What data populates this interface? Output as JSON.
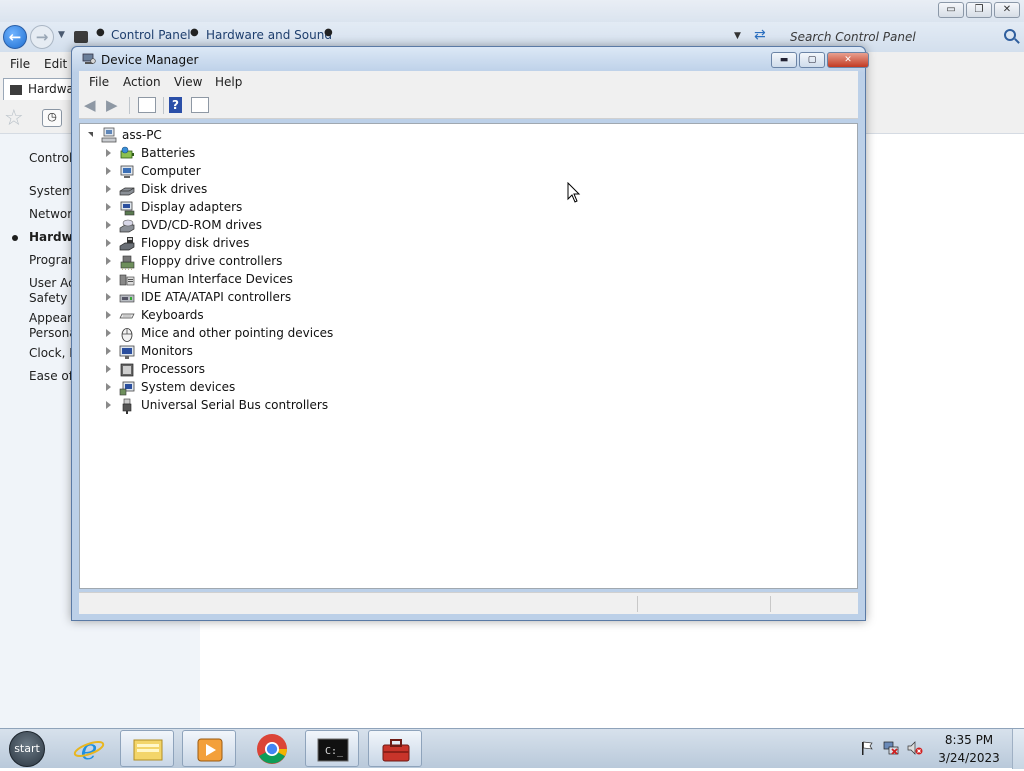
{
  "control_panel": {
    "window_buttons": {
      "minimize": "▭",
      "maximize": "❐",
      "close": "✕"
    },
    "breadcrumbs": [
      "Control Panel",
      "Hardware and Sound"
    ],
    "search_placeholder": "Search Control Panel",
    "menu": [
      "File",
      "Edit"
    ],
    "tab_label": "Hardwar",
    "sidebar": [
      {
        "label": "Control",
        "active": false
      },
      {
        "label": "System",
        "active": false
      },
      {
        "label": "Network",
        "active": false
      },
      {
        "label": "Hardwa",
        "active": true
      },
      {
        "label": "Program",
        "active": false
      },
      {
        "label": "User Ac",
        "active": false
      },
      {
        "label": "Safety",
        "active": false
      },
      {
        "label": "Appeara",
        "active": false
      },
      {
        "label": "Persona",
        "active": false
      },
      {
        "label": "Clock, L",
        "active": false
      },
      {
        "label": "Ease of A",
        "active": false
      }
    ]
  },
  "device_manager": {
    "title": "Device Manager",
    "menu": [
      "File",
      "Action",
      "View",
      "Help"
    ],
    "toolbar_icons": [
      "back-arrow-icon",
      "forward-arrow-icon",
      "properties-icon",
      "help-icon",
      "view-icon"
    ],
    "root": "ass-PC",
    "devices": [
      {
        "label": "Batteries",
        "icon": "battery-icon"
      },
      {
        "label": "Computer",
        "icon": "computer-icon"
      },
      {
        "label": "Disk drives",
        "icon": "disk-drive-icon"
      },
      {
        "label": "Display adapters",
        "icon": "display-adapter-icon"
      },
      {
        "label": "DVD/CD-ROM drives",
        "icon": "dvd-drive-icon"
      },
      {
        "label": "Floppy disk drives",
        "icon": "floppy-drive-icon"
      },
      {
        "label": "Floppy drive controllers",
        "icon": "floppy-controller-icon"
      },
      {
        "label": "Human Interface Devices",
        "icon": "hid-icon"
      },
      {
        "label": "IDE ATA/ATAPI controllers",
        "icon": "ide-controller-icon"
      },
      {
        "label": "Keyboards",
        "icon": "keyboard-icon"
      },
      {
        "label": "Mice and other pointing devices",
        "icon": "mouse-icon"
      },
      {
        "label": "Monitors",
        "icon": "monitor-icon"
      },
      {
        "label": "Processors",
        "icon": "processor-icon"
      },
      {
        "label": "System devices",
        "icon": "system-devices-icon"
      },
      {
        "label": "Universal Serial Bus controllers",
        "icon": "usb-icon"
      }
    ]
  },
  "taskbar": {
    "start_label": "start",
    "apps": [
      {
        "name": "Internet Explorer",
        "icon": "internet-explorer-icon"
      },
      {
        "name": "Windows Explorer",
        "icon": "file-explorer-icon"
      },
      {
        "name": "Media Player",
        "icon": "media-player-icon"
      },
      {
        "name": "Google Chrome",
        "icon": "chrome-icon"
      },
      {
        "name": "Command Prompt",
        "icon": "terminal-icon"
      },
      {
        "name": "Device Manager",
        "icon": "toolbox-icon"
      }
    ],
    "clock_time": "8:35 PM",
    "clock_date": "3/24/2023"
  },
  "colors": {
    "accent": "#1f6fd1",
    "close_red": "#c23a22",
    "window_frame": "#bcd0e8"
  }
}
